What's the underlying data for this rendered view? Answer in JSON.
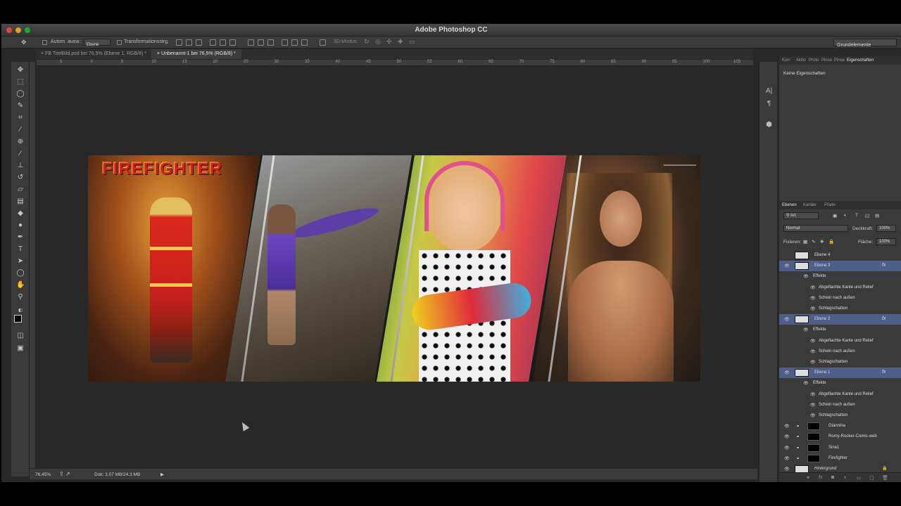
{
  "window": {
    "title": "Adobe Photoshop CC"
  },
  "options_bar": {
    "auto_select_label": "Autom. ausw.:",
    "auto_select_value": "Ebene",
    "transform_label": "Transformationsstrg.",
    "mode_3d_label": "3D-Modus:",
    "workspace": "Grundelemente"
  },
  "document_tabs": [
    {
      "label": "FB TitelBild.psd bei 76,5% (Ebene 1, RGB/8) *",
      "active": false
    },
    {
      "label": "Unbenannt-1 bei 76,5% (RGB/8) *",
      "active": true
    }
  ],
  "ruler": {
    "top_ticks": [
      "5",
      "0",
      "5",
      "10",
      "15",
      "20",
      "25",
      "30",
      "35",
      "40",
      "45",
      "50",
      "55",
      "60",
      "65",
      "70",
      "75",
      "80",
      "85",
      "90",
      "95",
      "100",
      "105"
    ]
  },
  "artwork": {
    "firefighter_title": "FIREFIGHTER",
    "panels": [
      "firefighter",
      "woman-in-purple-dress",
      "girl-with-toy-guitar",
      "woman-portrait"
    ]
  },
  "properties_panel": {
    "tabs": [
      "Korr",
      "Aktio",
      "Proto",
      "Pinse",
      "Pinse",
      "Eigenschaften"
    ],
    "active_tab": "Eigenschaften",
    "content": "Keine Eigenschaften"
  },
  "layers_panel": {
    "tabs": [
      "Ebenen",
      "Kanäle",
      "Pfade"
    ],
    "active_tab": "Ebenen",
    "filter_label": "Art",
    "blend_mode": "Normal",
    "opacity_label": "Deckkraft:",
    "opacity_value": "100%",
    "lock_label": "Fixieren:",
    "fill_label": "Fläche:",
    "fill_value": "100%",
    "layers": [
      {
        "name": "Ebene 4",
        "type": "layer",
        "visible": false,
        "selected": false
      },
      {
        "name": "Ebene 3",
        "type": "layer",
        "visible": true,
        "selected": true,
        "fx": true
      },
      {
        "name": "Effekte",
        "type": "effects",
        "visible": true
      },
      {
        "name": "Abgeflachte Kante und Relief",
        "type": "effect",
        "visible": true
      },
      {
        "name": "Schein nach außen",
        "type": "effect",
        "visible": true
      },
      {
        "name": "Schlagschatten",
        "type": "effect",
        "visible": true
      },
      {
        "name": "Ebene 2",
        "type": "layer",
        "visible": true,
        "selected": true,
        "fx": true
      },
      {
        "name": "Effekte",
        "type": "effects",
        "visible": true
      },
      {
        "name": "Abgeflachte Kante und Relief",
        "type": "effect",
        "visible": true
      },
      {
        "name": "Schein nach außen",
        "type": "effect",
        "visible": true
      },
      {
        "name": "Schlagschatten",
        "type": "effect",
        "visible": true
      },
      {
        "name": "Ebene 1",
        "type": "layer",
        "visible": true,
        "selected": true,
        "fx": true
      },
      {
        "name": "Effekte",
        "type": "effects",
        "visible": true
      },
      {
        "name": "Abgeflachte Kante und Relief",
        "type": "effect",
        "visible": true
      },
      {
        "name": "Schein nach außen",
        "type": "effect",
        "visible": true
      },
      {
        "name": "Schlagschatten",
        "type": "effect",
        "visible": true
      },
      {
        "name": "Giannina",
        "type": "masked",
        "visible": true
      },
      {
        "name": "Romy-Rocker-Comic-web",
        "type": "masked",
        "visible": true
      },
      {
        "name": "Sina1",
        "type": "masked",
        "visible": true
      },
      {
        "name": "Firefighter",
        "type": "masked",
        "visible": true
      },
      {
        "name": "Hintergrund",
        "type": "background",
        "visible": true,
        "locked": true
      }
    ]
  },
  "status_bar": {
    "zoom": "76,45%",
    "doc_info": "Dok: 3,07 MB/24,3 MB"
  },
  "colors": {
    "app_bg": "#282828",
    "panel_bg": "#3a3a3a",
    "selection": "#4e5e8a",
    "firefighter_red": "#d4231b"
  }
}
